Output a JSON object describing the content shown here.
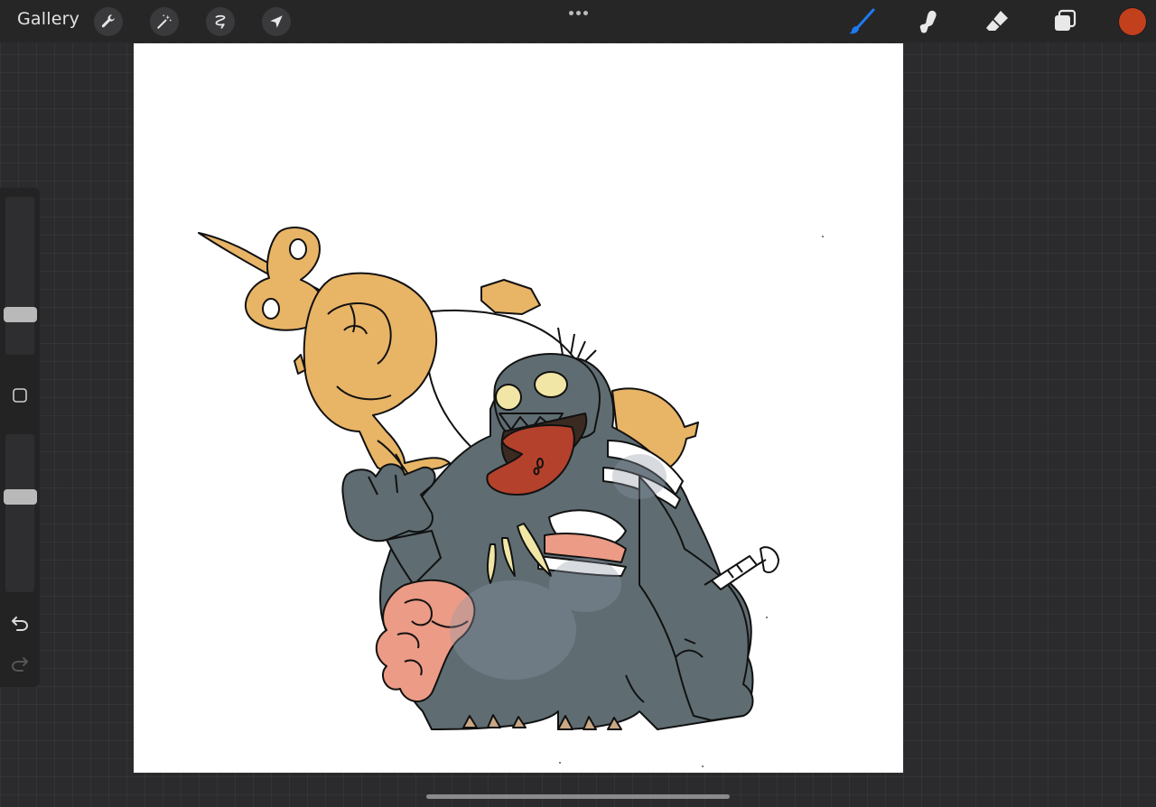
{
  "toolbar": {
    "gallery_label": "Gallery",
    "left_tools": [
      "wrench-icon",
      "magic-wand-icon",
      "selection-icon",
      "transform-arrow-icon"
    ],
    "right_tools": [
      "brush-icon",
      "smudge-icon",
      "eraser-icon",
      "layers-icon"
    ],
    "active_tool": "brush-icon",
    "current_color": "#c2401c",
    "accent_color": "#1d7af3"
  },
  "sidebar": {
    "brush_size": 0.5,
    "brush_opacity": 0.5,
    "controls": [
      "brush-size-slider",
      "modify-button",
      "opacity-slider",
      "undo-icon",
      "redo-icon"
    ]
  },
  "canvas": {
    "background": "#ffffff",
    "artwork_colors": [
      "#5f6d72",
      "#e8b466",
      "#b4412c",
      "#ec9b86",
      "#f2e6a6",
      "#8a5a3c"
    ]
  }
}
